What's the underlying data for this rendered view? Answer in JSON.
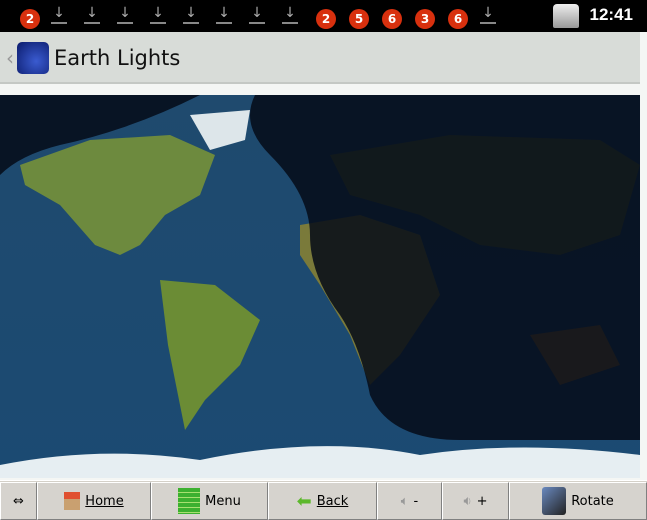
{
  "status_bar": {
    "badges": [
      "2",
      "2",
      "5",
      "6",
      "3",
      "6"
    ],
    "time": "12:41"
  },
  "title_bar": {
    "title": "Earth Lights"
  },
  "toolbar": {
    "resize": "⇔",
    "home": "Home",
    "menu": "Menu",
    "back": "Back",
    "vol_down": "-",
    "vol_up": "+",
    "rotate": "Rotate"
  }
}
